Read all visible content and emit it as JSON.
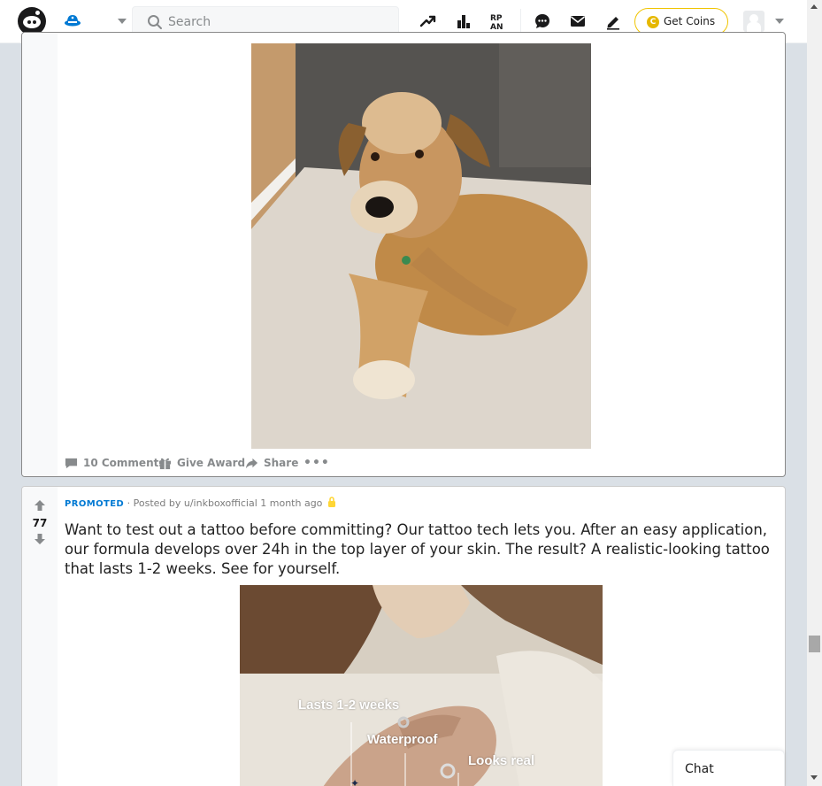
{
  "header": {
    "search_placeholder": "Search",
    "get_coins_label": "Get Coins",
    "coin_glyph": "C",
    "icons": [
      "popular-icon",
      "leaderboard-icon",
      "rpan-icon",
      "chat-icon",
      "inbox-icon",
      "create-post-icon"
    ],
    "brand_color": "#ff4500"
  },
  "post1": {
    "comments_label": "10 Comments",
    "award_label": "Give Award",
    "share_label": "Share",
    "more_glyph": "•••"
  },
  "post2": {
    "vote_count": "77",
    "promoted_label": "PROMOTED",
    "meta_text": " · Posted by u/inkboxofficial 1 month ago",
    "title": "Want to test out a tattoo before committing? Our tattoo tech lets you. After an easy application, our formula develops over 24h in the top layer of your skin. The result? A realistic-looking tattoo that lasts 1-2 weeks. See for yourself.",
    "image_labels": {
      "lasts": "Lasts 1-2 weeks",
      "waterproof": "Waterproof",
      "looks_real": "Looks real"
    }
  },
  "chat": {
    "label": "Chat"
  }
}
